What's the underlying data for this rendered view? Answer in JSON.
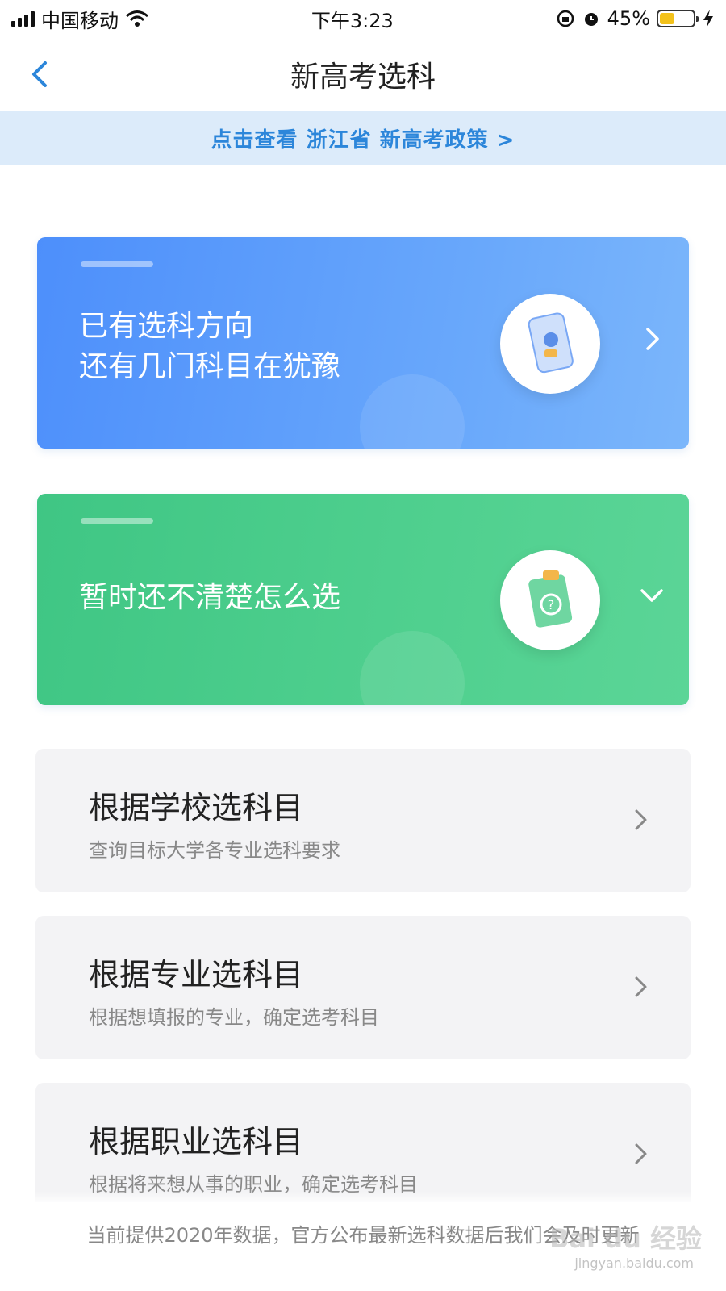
{
  "status_bar": {
    "carrier": "中国移动",
    "time": "下午3:23",
    "battery_percent": "45%",
    "battery_level": 0.45,
    "battery_color": "#f3c21b",
    "icons": [
      "signal-icon",
      "wifi-icon",
      "rotation-lock-icon",
      "alarm-icon",
      "battery-icon",
      "charging-icon"
    ]
  },
  "nav": {
    "title": "新高考选科",
    "back_icon": "chevron-left-icon"
  },
  "policy_banner": {
    "text": "点击查看 浙江省 新高考政策 >"
  },
  "cards": [
    {
      "line1": "已有选科方向",
      "line2": "还有几门科目在犹豫",
      "color": "#4d8ffb",
      "illustration": "phone-person-illustration",
      "arrow": "chevron-right-icon"
    },
    {
      "line1": "暂时还不清楚怎么选",
      "color": "#3fc684",
      "illustration": "clipboard-question-illustration",
      "arrow": "chevron-down-icon"
    }
  ],
  "options": [
    {
      "title": "根据学校选科目",
      "subtitle": "查询目标大学各专业选科要求"
    },
    {
      "title": "根据专业选科目",
      "subtitle": "根据想填报的专业，确定选考科目"
    },
    {
      "title": "根据职业选科目",
      "subtitle": "根据将来想从事的职业，确定选考科目"
    }
  ],
  "footer": {
    "notice": "当前提供2020年数据，官方公布最新选科数据后我们会及时更新"
  },
  "watermark": {
    "brand": "Bai du 经验",
    "url": "jingyan.baidu.com"
  }
}
